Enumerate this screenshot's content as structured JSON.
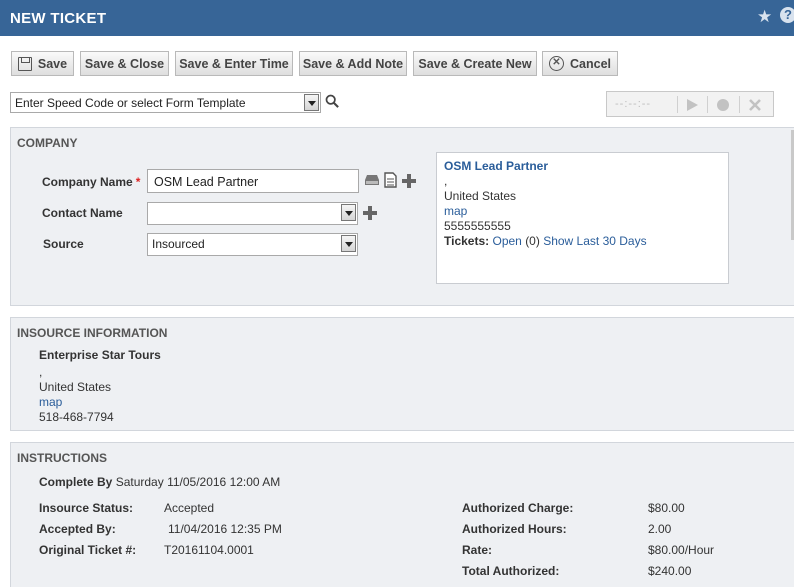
{
  "header": {
    "title": "NEW TICKET",
    "star_icon": "star-icon",
    "help_icon": "help-icon",
    "help_glyph": "?"
  },
  "toolbar": {
    "save": "Save",
    "save_close": "Save & Close",
    "save_enter_time": "Save & Enter Time",
    "save_add_note": "Save & Add Note",
    "save_create_new": "Save & Create New",
    "cancel": "Cancel"
  },
  "speed_code": {
    "value": "Enter Speed Code or select Form Template"
  },
  "timer": {
    "time": "--:--:--"
  },
  "company": {
    "heading": "COMPANY",
    "company_name_label": "Company Name",
    "company_name_value": "OSM Lead Partner",
    "contact_name_label": "Contact Name",
    "contact_name_value": "",
    "source_label": "Source",
    "source_value": "Insourced",
    "info": {
      "name": "OSM Lead Partner",
      "line1": ",",
      "country": "United States",
      "map": "map",
      "phone": "5555555555",
      "tickets_label": "Tickets:",
      "open": "Open",
      "open_count": "(0)",
      "show_last": "Show Last 30 Days"
    }
  },
  "insource": {
    "heading": "INSOURCE INFORMATION",
    "name": "Enterprise Star Tours",
    "line1": ",",
    "country": "United States",
    "map": "map",
    "phone": "518-468-7794"
  },
  "instructions": {
    "heading": "INSTRUCTIONS",
    "complete_by_label": "Complete By",
    "complete_by_value": "Saturday 11/05/2016 12:00 AM",
    "insource_status_label": "Insource Status:",
    "insource_status_value": "Accepted",
    "accepted_by_label": "Accepted By:",
    "accepted_by_value": "11/04/2016 12:35 PM",
    "original_ticket_label": "Original Ticket #:",
    "original_ticket_value": "T20161104.0001",
    "authorized_charge_label": "Authorized Charge:",
    "authorized_charge_value": "$80.00",
    "authorized_hours_label": "Authorized Hours:",
    "authorized_hours_value": "2.00",
    "rate_label": "Rate:",
    "rate_value": "$80.00/Hour",
    "total_authorized_label": "Total Authorized:",
    "total_authorized_value": "$240.00"
  }
}
